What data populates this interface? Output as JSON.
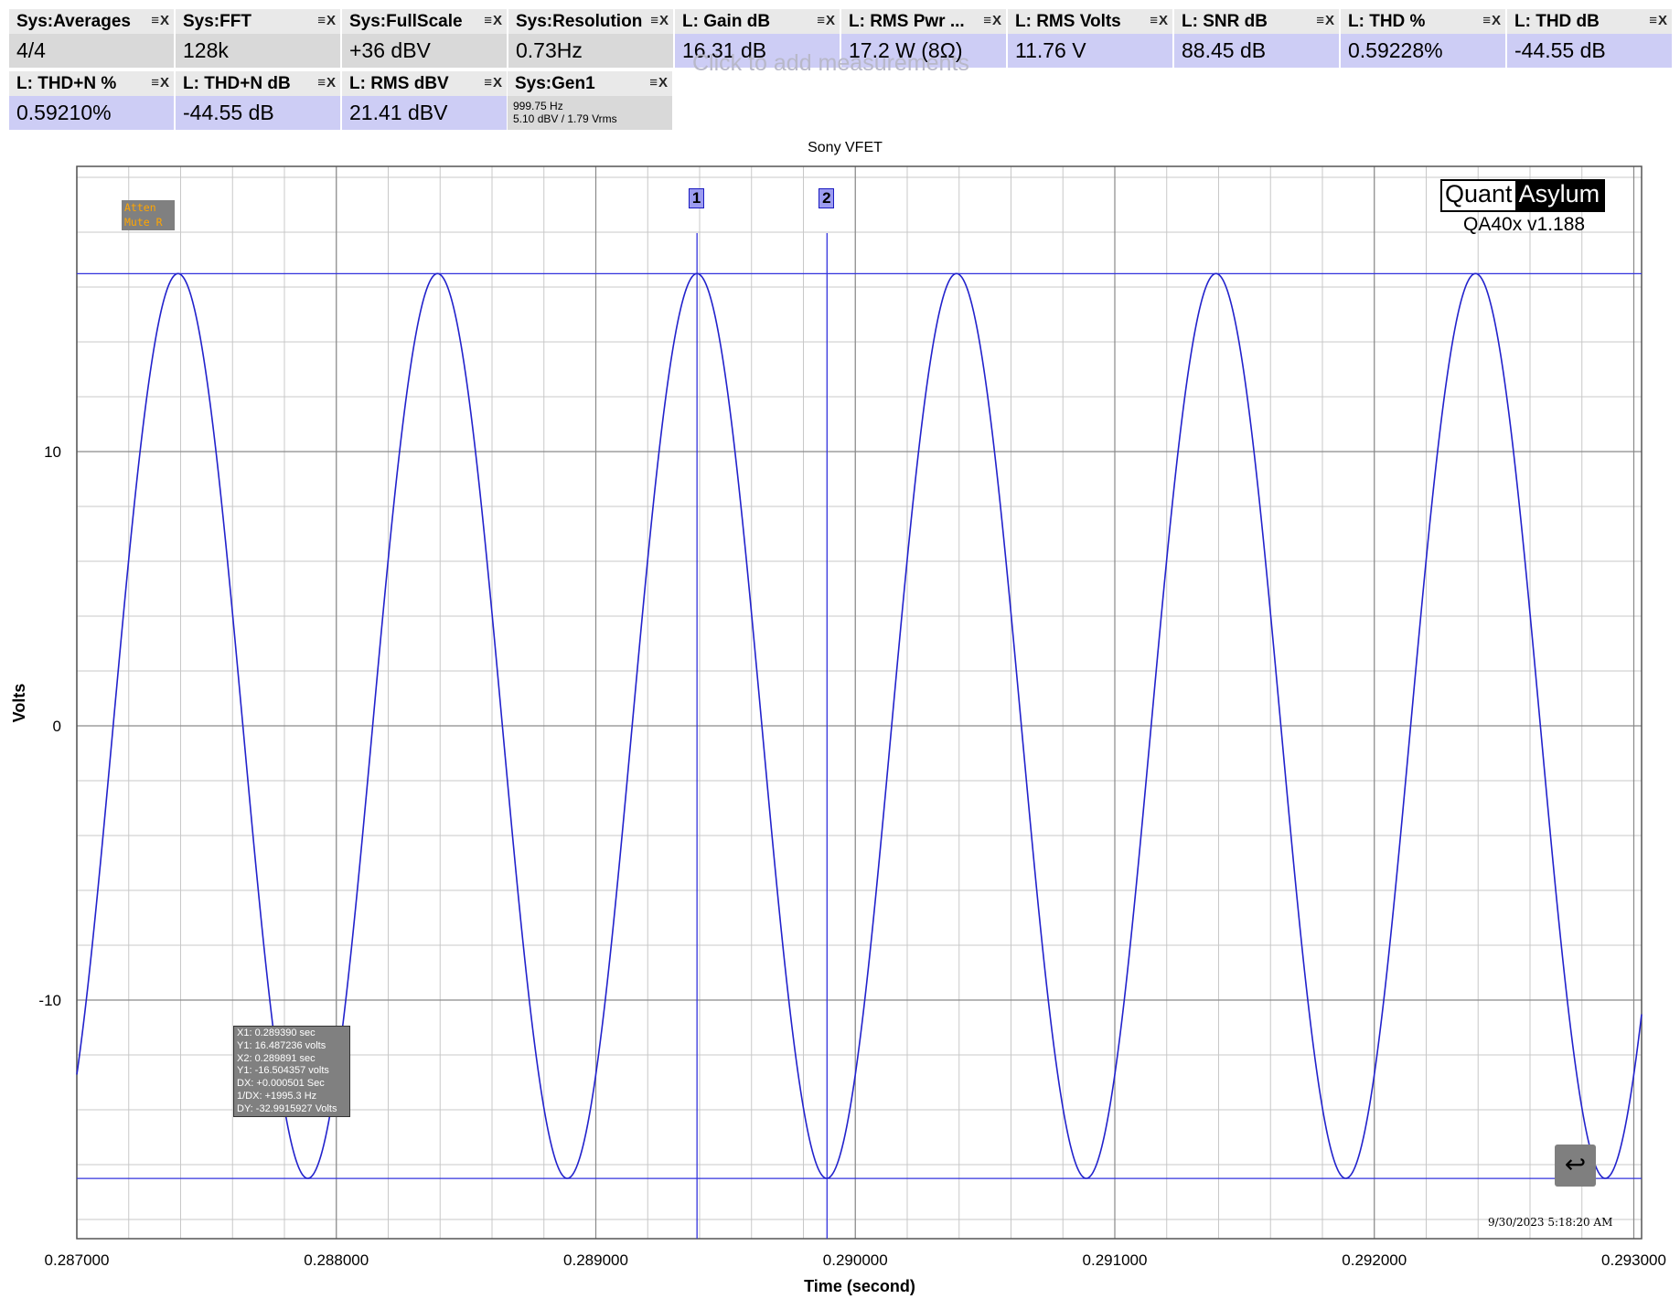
{
  "measurements_row1": [
    {
      "title": "Sys:Averages",
      "value": "4/4",
      "style": "gray"
    },
    {
      "title": "Sys:FFT",
      "value": "128k",
      "style": "gray"
    },
    {
      "title": "Sys:FullScale",
      "value": "+36 dBV",
      "style": "gray"
    },
    {
      "title": "Sys:Resolution",
      "value": "0.73Hz",
      "style": "gray"
    },
    {
      "title": "L: Gain dB",
      "value": "16.31 dB",
      "style": "blue"
    },
    {
      "title": "L: RMS Pwr ...",
      "value": "17.2 W (8Ω)",
      "style": "blue"
    },
    {
      "title": "L: RMS Volts",
      "value": "11.76 V",
      "style": "blue"
    },
    {
      "title": "L: SNR dB",
      "value": "88.45 dB",
      "style": "blue"
    },
    {
      "title": "L: THD %",
      "value": "0.59228%",
      "style": "blue"
    },
    {
      "title": "L: THD dB",
      "value": "-44.55 dB",
      "style": "blue"
    }
  ],
  "measurements_row2": [
    {
      "title": "L: THD+N %",
      "value": "0.59210%",
      "style": "blue"
    },
    {
      "title": "L: THD+N dB",
      "value": "-44.55 dB",
      "style": "blue"
    },
    {
      "title": "L: RMS dBV",
      "value": "21.41 dBV",
      "style": "blue"
    }
  ],
  "gen1": {
    "title": "Sys:Gen1",
    "line1": "999.75 Hz",
    "line2": "5.10 dBV  / 1.79 Vrms"
  },
  "tile_controls": "≡X",
  "click_hint": "Click to add measurements",
  "chart_data": {
    "type": "line",
    "title": "Sony VFET",
    "xlabel": "Time (second)",
    "ylabel": "Volts",
    "xlim": [
      0.287,
      0.29303
    ],
    "ylim": [
      -18.7,
      20.4
    ],
    "x_ticks": [
      0.287,
      0.288,
      0.289,
      0.29,
      0.291,
      0.292,
      0.293
    ],
    "x_tick_labels": [
      "0.287000",
      "0.288000",
      "0.289000",
      "0.290000",
      "0.291000",
      "0.292000",
      "0.293000"
    ],
    "y_ticks": [
      -10,
      0,
      10
    ],
    "y_tick_labels": [
      "-10",
      "0",
      "10"
    ],
    "grid": true,
    "series": [
      {
        "frequency_hz": 1000,
        "amplitude_pos": 16.49,
        "amplitude_neg": -16.5,
        "peak_time": 0.28739,
        "color": "#2222cc"
      }
    ],
    "cursors": [
      {
        "label": "1",
        "x": 0.28939,
        "y": 16.487236
      },
      {
        "label": "2",
        "x": 0.289891,
        "y": -16.504357
      }
    ]
  },
  "cursor_readout": [
    "X1: 0.289390 sec",
    "Y1: 16.487236 volts",
    "X2: 0.289891 sec",
    "Y1: -16.504357 volts",
    "DX: +0.000501 Sec",
    "1/DX: +1995.3 Hz",
    "DY: -32.9915927 Volts"
  ],
  "atten_lines": [
    "Atten",
    "Mute R"
  ],
  "logo": {
    "quant": "Quant",
    "asylum": "Asylum"
  },
  "version": "QA40x v1.188",
  "timestamp": "9/30/2023 5:18:20 AM",
  "back_icon": "↩"
}
